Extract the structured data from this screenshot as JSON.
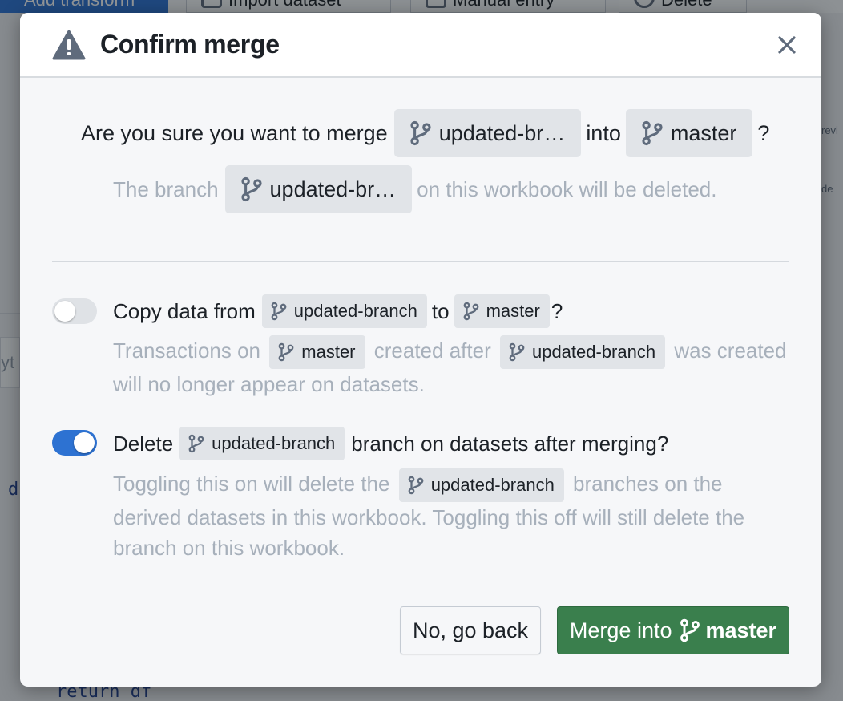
{
  "background": {
    "primary_tab": "Add transform",
    "tabs": [
      "Import dataset",
      "Manual entry",
      "Delete"
    ],
    "code_lines": [
      "d",
      "return df"
    ],
    "side_text": [
      "revi",
      "de"
    ],
    "field_text": "yt"
  },
  "dialog": {
    "title": "Confirm merge",
    "question": {
      "prefix": "Are you sure you want to merge",
      "source_branch": "updated-br…",
      "middle": "into",
      "target_branch": "master",
      "suffix": "?"
    },
    "subtext": {
      "prefix": "The branch",
      "branch": "updated-br…",
      "suffix": "on this workbook will be deleted."
    },
    "options": [
      {
        "enabled": false,
        "label_prefix": "Copy data from",
        "source_branch": "updated-branch",
        "label_mid": "to",
        "target_branch": "master",
        "label_suffix": "?",
        "desc_prefix": "Transactions on",
        "desc_branch1": "master",
        "desc_mid": "created after",
        "desc_branch2": "updated-branch",
        "desc_suffix": "was created will no longer appear on datasets."
      },
      {
        "enabled": true,
        "label_prefix": "Delete",
        "branch": "updated-branch",
        "label_suffix": "branch on datasets after merging?",
        "desc_prefix": "Toggling this on will delete the",
        "desc_branch": "updated-branch",
        "desc_suffix": "branches on the derived datasets in this workbook. Toggling this off will still delete the branch on this workbook."
      }
    ],
    "buttons": {
      "cancel": "No, go back",
      "confirm_prefix": "Merge into",
      "confirm_branch": "master"
    }
  },
  "colors": {
    "primary_blue": "#2d72d2",
    "confirm_green": "#3a7f4d",
    "muted_text": "#a7b0bb"
  },
  "icons": [
    "warning-icon",
    "close-icon",
    "git-branch-icon"
  ]
}
